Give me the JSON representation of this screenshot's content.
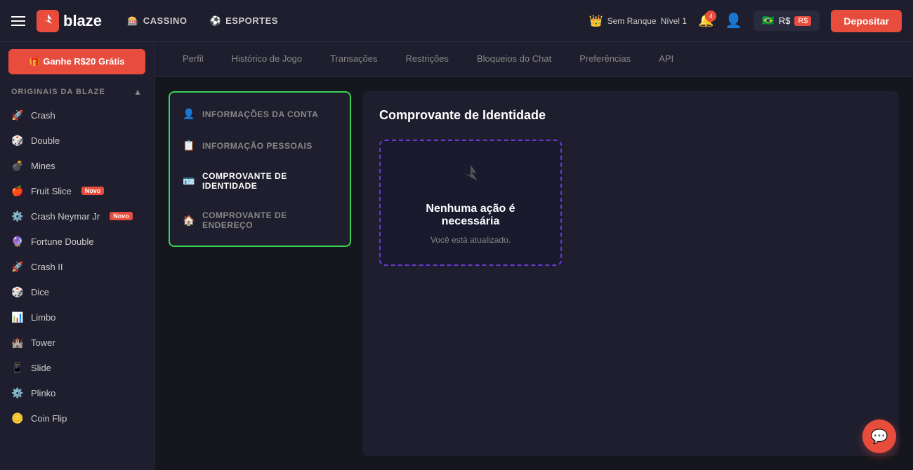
{
  "header": {
    "hamburger_label": "menu",
    "logo_text": "blaze",
    "nav": [
      {
        "id": "cassino",
        "label": "CASSINO",
        "icon": "🎰"
      },
      {
        "id": "esportes",
        "label": "ESPORTES",
        "icon": "⚽"
      }
    ],
    "rank_label": "Sem Ranque",
    "level_label": "Nível 1",
    "notification_count": "4",
    "balance_currency": "R$",
    "deposit_label": "Depositar"
  },
  "sidebar": {
    "bonus_label": "🎁 Ganhe R$20 Grátis",
    "section_label": "ORIGINAIS DA BLAZE",
    "items": [
      {
        "id": "crash",
        "label": "Crash",
        "icon": "🚀"
      },
      {
        "id": "double",
        "label": "Double",
        "icon": "🎲"
      },
      {
        "id": "mines",
        "label": "Mines",
        "icon": "💣"
      },
      {
        "id": "fruit-slice",
        "label": "Fruit Slice",
        "badge": "Novo",
        "icon": "🍎"
      },
      {
        "id": "crash-neymar",
        "label": "Crash Neymar Jr",
        "badge": "Novo",
        "icon": "⚙️"
      },
      {
        "id": "fortune-double",
        "label": "Fortune Double",
        "icon": "🔮"
      },
      {
        "id": "crash-ii",
        "label": "Crash II",
        "icon": "🚀"
      },
      {
        "id": "dice",
        "label": "Dice",
        "icon": "🎲"
      },
      {
        "id": "limbo",
        "label": "Limbo",
        "icon": "📊"
      },
      {
        "id": "tower",
        "label": "Tower",
        "icon": "🏰"
      },
      {
        "id": "slide",
        "label": "Slide",
        "icon": "📱"
      },
      {
        "id": "plinko",
        "label": "Plinko",
        "icon": "⚙️"
      },
      {
        "id": "coin-flip",
        "label": "Coin Flip",
        "icon": "🪙"
      }
    ]
  },
  "profile_tabs": [
    {
      "id": "perfil",
      "label": "Perfil",
      "active": false
    },
    {
      "id": "historico",
      "label": "Histórico de Jogo",
      "active": false
    },
    {
      "id": "transacoes",
      "label": "Transações",
      "active": false
    },
    {
      "id": "restricoes",
      "label": "Restrições",
      "active": false
    },
    {
      "id": "bloqueios",
      "label": "Bloqueios do Chat",
      "active": false
    },
    {
      "id": "preferencias",
      "label": "Preferências",
      "active": false
    },
    {
      "id": "api",
      "label": "API",
      "active": false
    }
  ],
  "profile_menu": {
    "items": [
      {
        "id": "info-conta",
        "label": "INFORMAÇÕES DA CONTA",
        "icon": "👤",
        "active": false
      },
      {
        "id": "info-pessoais",
        "label": "INFORMAÇÃO PESSOAIS",
        "icon": "📋",
        "active": false
      },
      {
        "id": "comprovante-identidade",
        "label": "COMPROVANTE DE IDENTIDADE",
        "icon": "🪪",
        "active": true
      },
      {
        "id": "comprovante-endereco",
        "label": "COMPROVANTE DE ENDEREÇO",
        "icon": "🏠",
        "active": false
      }
    ]
  },
  "identity": {
    "title": "Comprovante de Identidade",
    "card_title": "Nenhuma ação é\nnecessária",
    "card_subtitle": "Você está atualizado."
  },
  "chat_fab_icon": "💬"
}
